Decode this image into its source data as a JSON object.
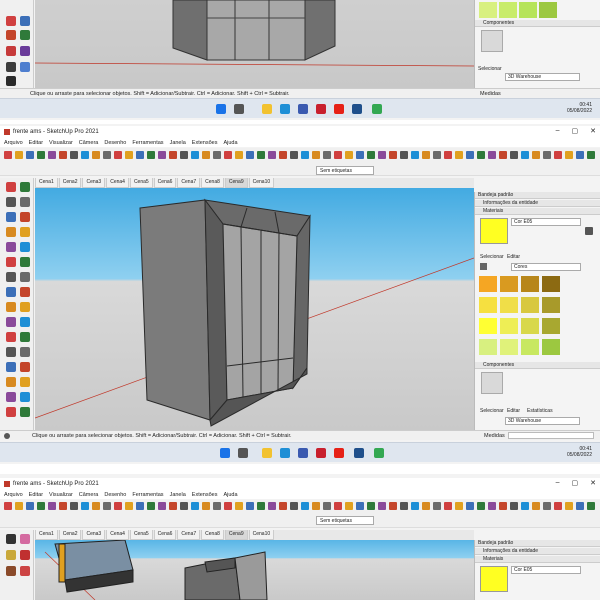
{
  "app": {
    "title": "frente ams - SketchUp Pro 2021"
  },
  "menu": [
    "Arquivo",
    "Editar",
    "Visualizar",
    "Câmera",
    "Desenho",
    "Ferramentas",
    "Janela",
    "Extensões",
    "Ajuda"
  ],
  "toolbar": {
    "tag_dropdown": "Sem etiquetas"
  },
  "scenes": [
    "Cena1",
    "Cena2",
    "Cena3",
    "Cena4",
    "Cena5",
    "Cena6",
    "Cena7",
    "Cena8",
    "Cena9",
    "Cena10"
  ],
  "active_scene": "Cena9",
  "tray": {
    "title": "Bandeja padrão",
    "entity_info": "Informações da entidade",
    "materials": "Materiais",
    "material_name": "Cor E05",
    "select_tab": "Selecionar",
    "edit_tab": "Editar",
    "stats_tab": "Estatísticas",
    "library": "Cores",
    "components": "Componentes",
    "warehouse_placeholder": "3D Warehouse",
    "swatches": [
      "#f5a623",
      "#d99a20",
      "#b7861a",
      "#8c6a12",
      "#f6e040",
      "#f0de48",
      "#d8c840",
      "#a89a2a",
      "#ffff33",
      "#eeee55",
      "#d8d84a",
      "#a8a830",
      "#d8f080",
      "#e0f27a",
      "#c8e860",
      "#9cc840"
    ]
  },
  "status": {
    "hint": "Clique ou arraste para selecionar objetos. Shift = Adicionar/Subtrair. Ctrl = Adicionar. Shift + Ctrl = Subtrair.",
    "measures_label": "Medidas"
  },
  "taskbar": {
    "time": "00:41",
    "date": "05/08/2022"
  },
  "colors": {
    "accent": "#1a73e8",
    "sky": "#3aa6e0",
    "ground": "#cfcfcf"
  }
}
